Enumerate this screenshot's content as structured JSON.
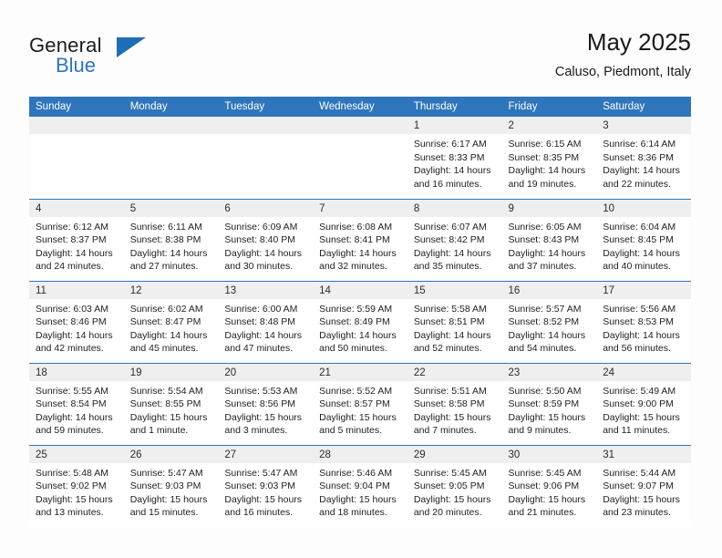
{
  "brand": {
    "name_top": "General",
    "name_bottom": "Blue",
    "triangle_icon": "triangle-logo-icon",
    "accent_color": "#2e75bb"
  },
  "header": {
    "title": "May 2025",
    "subtitle": "Caluso, Piedmont, Italy"
  },
  "calendar": {
    "weekday_headers": [
      "Sunday",
      "Monday",
      "Tuesday",
      "Wednesday",
      "Thursday",
      "Friday",
      "Saturday"
    ],
    "header_bg": "#2e75bb",
    "daynum_bg": "#efefef",
    "weeks": [
      [
        {
          "day": "",
          "empty": true
        },
        {
          "day": "",
          "empty": true
        },
        {
          "day": "",
          "empty": true
        },
        {
          "day": "",
          "empty": true
        },
        {
          "day": "1",
          "sunrise": "Sunrise: 6:17 AM",
          "sunset": "Sunset: 8:33 PM",
          "daylight1": "Daylight: 14 hours",
          "daylight2": "and 16 minutes."
        },
        {
          "day": "2",
          "sunrise": "Sunrise: 6:15 AM",
          "sunset": "Sunset: 8:35 PM",
          "daylight1": "Daylight: 14 hours",
          "daylight2": "and 19 minutes."
        },
        {
          "day": "3",
          "sunrise": "Sunrise: 6:14 AM",
          "sunset": "Sunset: 8:36 PM",
          "daylight1": "Daylight: 14 hours",
          "daylight2": "and 22 minutes."
        }
      ],
      [
        {
          "day": "4",
          "sunrise": "Sunrise: 6:12 AM",
          "sunset": "Sunset: 8:37 PM",
          "daylight1": "Daylight: 14 hours",
          "daylight2": "and 24 minutes."
        },
        {
          "day": "5",
          "sunrise": "Sunrise: 6:11 AM",
          "sunset": "Sunset: 8:38 PM",
          "daylight1": "Daylight: 14 hours",
          "daylight2": "and 27 minutes."
        },
        {
          "day": "6",
          "sunrise": "Sunrise: 6:09 AM",
          "sunset": "Sunset: 8:40 PM",
          "daylight1": "Daylight: 14 hours",
          "daylight2": "and 30 minutes."
        },
        {
          "day": "7",
          "sunrise": "Sunrise: 6:08 AM",
          "sunset": "Sunset: 8:41 PM",
          "daylight1": "Daylight: 14 hours",
          "daylight2": "and 32 minutes."
        },
        {
          "day": "8",
          "sunrise": "Sunrise: 6:07 AM",
          "sunset": "Sunset: 8:42 PM",
          "daylight1": "Daylight: 14 hours",
          "daylight2": "and 35 minutes."
        },
        {
          "day": "9",
          "sunrise": "Sunrise: 6:05 AM",
          "sunset": "Sunset: 8:43 PM",
          "daylight1": "Daylight: 14 hours",
          "daylight2": "and 37 minutes."
        },
        {
          "day": "10",
          "sunrise": "Sunrise: 6:04 AM",
          "sunset": "Sunset: 8:45 PM",
          "daylight1": "Daylight: 14 hours",
          "daylight2": "and 40 minutes."
        }
      ],
      [
        {
          "day": "11",
          "sunrise": "Sunrise: 6:03 AM",
          "sunset": "Sunset: 8:46 PM",
          "daylight1": "Daylight: 14 hours",
          "daylight2": "and 42 minutes."
        },
        {
          "day": "12",
          "sunrise": "Sunrise: 6:02 AM",
          "sunset": "Sunset: 8:47 PM",
          "daylight1": "Daylight: 14 hours",
          "daylight2": "and 45 minutes."
        },
        {
          "day": "13",
          "sunrise": "Sunrise: 6:00 AM",
          "sunset": "Sunset: 8:48 PM",
          "daylight1": "Daylight: 14 hours",
          "daylight2": "and 47 minutes."
        },
        {
          "day": "14",
          "sunrise": "Sunrise: 5:59 AM",
          "sunset": "Sunset: 8:49 PM",
          "daylight1": "Daylight: 14 hours",
          "daylight2": "and 50 minutes."
        },
        {
          "day": "15",
          "sunrise": "Sunrise: 5:58 AM",
          "sunset": "Sunset: 8:51 PM",
          "daylight1": "Daylight: 14 hours",
          "daylight2": "and 52 minutes."
        },
        {
          "day": "16",
          "sunrise": "Sunrise: 5:57 AM",
          "sunset": "Sunset: 8:52 PM",
          "daylight1": "Daylight: 14 hours",
          "daylight2": "and 54 minutes."
        },
        {
          "day": "17",
          "sunrise": "Sunrise: 5:56 AM",
          "sunset": "Sunset: 8:53 PM",
          "daylight1": "Daylight: 14 hours",
          "daylight2": "and 56 minutes."
        }
      ],
      [
        {
          "day": "18",
          "sunrise": "Sunrise: 5:55 AM",
          "sunset": "Sunset: 8:54 PM",
          "daylight1": "Daylight: 14 hours",
          "daylight2": "and 59 minutes."
        },
        {
          "day": "19",
          "sunrise": "Sunrise: 5:54 AM",
          "sunset": "Sunset: 8:55 PM",
          "daylight1": "Daylight: 15 hours",
          "daylight2": "and 1 minute."
        },
        {
          "day": "20",
          "sunrise": "Sunrise: 5:53 AM",
          "sunset": "Sunset: 8:56 PM",
          "daylight1": "Daylight: 15 hours",
          "daylight2": "and 3 minutes."
        },
        {
          "day": "21",
          "sunrise": "Sunrise: 5:52 AM",
          "sunset": "Sunset: 8:57 PM",
          "daylight1": "Daylight: 15 hours",
          "daylight2": "and 5 minutes."
        },
        {
          "day": "22",
          "sunrise": "Sunrise: 5:51 AM",
          "sunset": "Sunset: 8:58 PM",
          "daylight1": "Daylight: 15 hours",
          "daylight2": "and 7 minutes."
        },
        {
          "day": "23",
          "sunrise": "Sunrise: 5:50 AM",
          "sunset": "Sunset: 8:59 PM",
          "daylight1": "Daylight: 15 hours",
          "daylight2": "and 9 minutes."
        },
        {
          "day": "24",
          "sunrise": "Sunrise: 5:49 AM",
          "sunset": "Sunset: 9:00 PM",
          "daylight1": "Daylight: 15 hours",
          "daylight2": "and 11 minutes."
        }
      ],
      [
        {
          "day": "25",
          "sunrise": "Sunrise: 5:48 AM",
          "sunset": "Sunset: 9:02 PM",
          "daylight1": "Daylight: 15 hours",
          "daylight2": "and 13 minutes."
        },
        {
          "day": "26",
          "sunrise": "Sunrise: 5:47 AM",
          "sunset": "Sunset: 9:03 PM",
          "daylight1": "Daylight: 15 hours",
          "daylight2": "and 15 minutes."
        },
        {
          "day": "27",
          "sunrise": "Sunrise: 5:47 AM",
          "sunset": "Sunset: 9:03 PM",
          "daylight1": "Daylight: 15 hours",
          "daylight2": "and 16 minutes."
        },
        {
          "day": "28",
          "sunrise": "Sunrise: 5:46 AM",
          "sunset": "Sunset: 9:04 PM",
          "daylight1": "Daylight: 15 hours",
          "daylight2": "and 18 minutes."
        },
        {
          "day": "29",
          "sunrise": "Sunrise: 5:45 AM",
          "sunset": "Sunset: 9:05 PM",
          "daylight1": "Daylight: 15 hours",
          "daylight2": "and 20 minutes."
        },
        {
          "day": "30",
          "sunrise": "Sunrise: 5:45 AM",
          "sunset": "Sunset: 9:06 PM",
          "daylight1": "Daylight: 15 hours",
          "daylight2": "and 21 minutes."
        },
        {
          "day": "31",
          "sunrise": "Sunrise: 5:44 AM",
          "sunset": "Sunset: 9:07 PM",
          "daylight1": "Daylight: 15 hours",
          "daylight2": "and 23 minutes."
        }
      ]
    ]
  }
}
